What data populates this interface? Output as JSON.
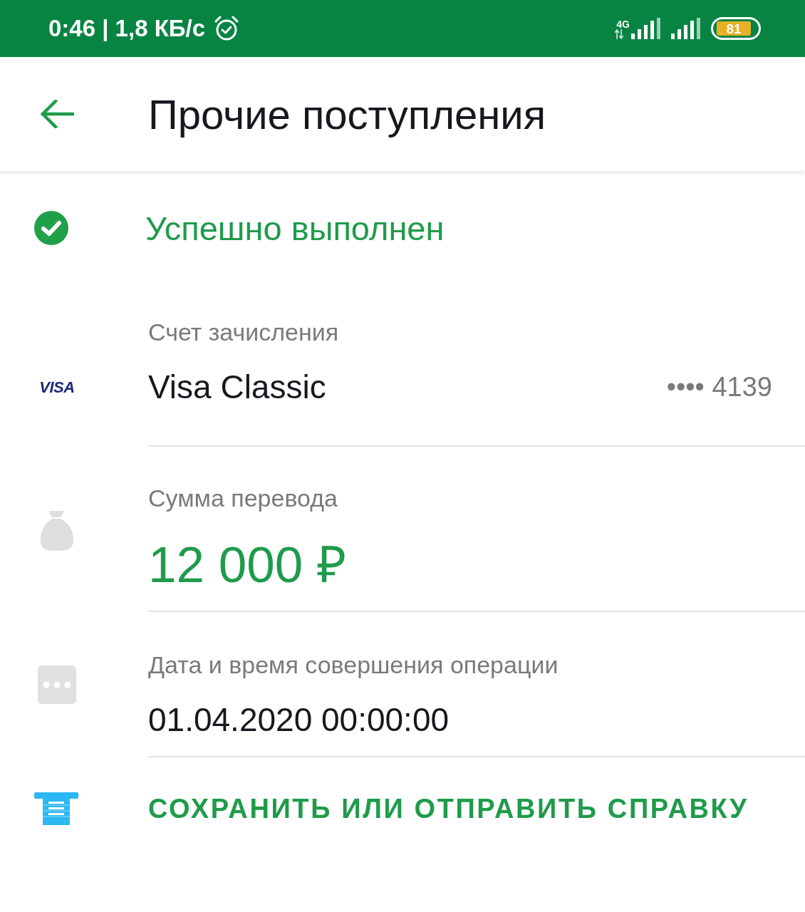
{
  "status_bar": {
    "time_speed": "0:46 | 1,8 КБ/с",
    "network": "4G",
    "battery": "81"
  },
  "header": {
    "title": "Прочие поступления"
  },
  "status": {
    "kind": "success",
    "text": "Успешно выполнен"
  },
  "fields": [
    {
      "kind": "card",
      "label": "Счет зачисления",
      "logo": "VISA",
      "value": "Visa Classic",
      "number": "•••• 4139"
    },
    {
      "kind": "amount",
      "label": "Сумма перевода",
      "value": "12 000 ₽"
    },
    {
      "kind": "datetime",
      "label": "Дата и время совершения операции",
      "value": "01.04.2020 00:00:00"
    }
  ],
  "action": {
    "label": "СОХРАНИТЬ ИЛИ ОТПРАВИТЬ СПРАВКУ"
  }
}
